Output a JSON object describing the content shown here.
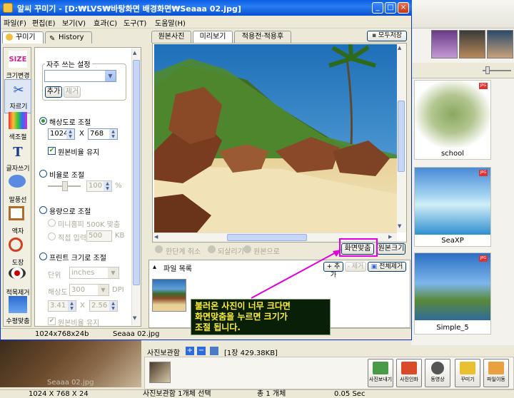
{
  "window": {
    "title": "알씨 꾸미기 - [D:₩LVS₩바탕화면 배경화면₩Seaaa 02.jpg]",
    "min": "_",
    "max": "□",
    "close": "×"
  },
  "menu": [
    "파일(F)",
    "편집(E)",
    "보기(V)",
    "효과(C)",
    "도구(T)",
    "도움말(H)"
  ],
  "left_tabs": {
    "decorate": "꾸미기",
    "history": "History"
  },
  "tools": [
    {
      "label": "크기변경",
      "icon": "SIZE"
    },
    {
      "label": "자르기",
      "icon": "✂"
    },
    {
      "label": "색조절",
      "icon": ""
    },
    {
      "label": "글자쓰기",
      "icon": "T"
    },
    {
      "label": "말풍선",
      "icon": ""
    },
    {
      "label": "액자",
      "icon": ""
    },
    {
      "label": "도장",
      "icon": ""
    },
    {
      "label": "적목제거",
      "icon": ""
    },
    {
      "label": "수평맞춤",
      "icon": ""
    }
  ],
  "settings": {
    "favorites_title": "자주 쓰는 설정",
    "add": "추가",
    "remove": "제거",
    "resolution_label": "해상도로 조절",
    "width": "1024",
    "x": "X",
    "height": "768",
    "keep_ratio": "원본비율 유지",
    "ratio_label": "비율로 조절",
    "ratio_value": "100",
    "percent": "%",
    "capacity_label": "용량으로 조절",
    "mini_opt": "미니홈피 500K 맞춤",
    "direct_opt": "직접 입력",
    "direct_value": "500",
    "kb": "KB",
    "print_label": "프린트 크기로 조절",
    "unit_label": "단위",
    "unit_value": "inches",
    "dpi_label": "해상도",
    "dpi_value": "300",
    "dpi": "DPI",
    "pw": "3.41",
    "ph": "2.56",
    "keep_ratio2": "원본비율 유지"
  },
  "preview_tabs": [
    "원본사진",
    "미리보기",
    "적용전·적용후"
  ],
  "save_all": "모두저장",
  "controls": {
    "undo": "한단계 취소",
    "redo": "되살리기",
    "original": "원본으로",
    "fit": "화면맞춤",
    "orig_size": "원본크기"
  },
  "filelist": {
    "title": "파일 목록",
    "add": "+ 추가",
    "remove": "- 제거",
    "remove_all": "전체제거"
  },
  "status": {
    "size": "1024x768x24b",
    "file": "Seaaa 02.jpg"
  },
  "annotation": "불러온 사진이 너무 크다면\n화면맞춤을 누르면 크기가\n조절 됩니다.",
  "background_app": {
    "cards": [
      "school",
      "SeaXP",
      "Simple_5"
    ],
    "bottom_file": "Seaaa 02.jpg",
    "album_title": "사진보관함",
    "album_count": "[1장 429.38KB]",
    "big_buttons": [
      "사진보내기",
      "사진인화",
      "동영상",
      "꾸미기",
      "파일이동"
    ],
    "status_dims": "1024 X 768 X 24",
    "status_album": "사진보관함 1개체 선택",
    "status_total": "총 1 개체",
    "status_time": "0.05 Sec"
  },
  "colors": {
    "title_bar": "#0a5de4",
    "highlight": "#e000e0",
    "annotation_text": "#ffef3a",
    "annotation_bg": "#0a1f08"
  }
}
